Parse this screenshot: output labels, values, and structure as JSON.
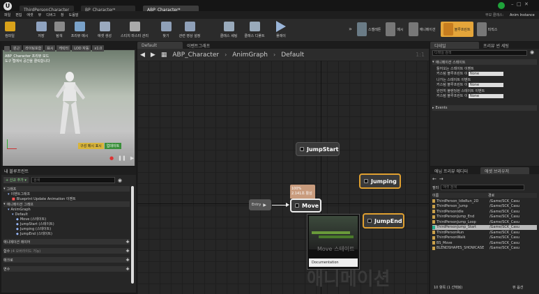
{
  "tabs": {
    "t1": "ThirdPersonCharacter",
    "t2": "BP_Character*",
    "t3": "ABP_Character*"
  },
  "menu": [
    "파일",
    "편집",
    "애셋",
    "뷰",
    "디버그",
    "창",
    "도움말"
  ],
  "top_right": {
    "parent": "부모 클래스:",
    "parent_value": "Anim Instance"
  },
  "toolbar": [
    "컴파일",
    "저장",
    "탐색",
    "프리뷰 메시",
    "애셋 생성",
    "스티치 마스터 관리",
    "찾기",
    "클래스 세팅",
    "클래스 디폴트",
    "플레이"
  ],
  "toolbar_misc": "관련 영상 설정",
  "modes": [
    "스켈레톤",
    "메시",
    "애니메이션",
    "블루프린트",
    "피직스"
  ],
  "viewport": {
    "buttons": [
      "원근",
      "라이팅포함",
      "표시",
      "캐릭터",
      "LOD 자동",
      "x1.0"
    ],
    "info1": "ABP_Character 프리뷰 모드",
    "info2": "도구 탭에서 공간을 클릭합니다",
    "overlay1": "구성 메시 표시",
    "overlay2": "업데이트"
  },
  "mybp": {
    "title": "내 블루프린트",
    "add": "+ 신규 추가 ▾",
    "search": "검색",
    "sec_graph": "그래프",
    "eventgraph": "이벤트그래프",
    "bp_update": "Blueprint Update Animation 이벤트",
    "animgraph_sec": "애니메이션 그래프",
    "animgraph": "AnimGraph",
    "default": "Default",
    "items": [
      "Move (스테이트)",
      "JumpStart (스테이트)",
      "Jumping (스테이트)",
      "JumpEnd (스테이트)"
    ],
    "anim_layers": "애니메이션 레이어",
    "functions": "함수",
    "functions_count": "(4 오버라이드 가능)",
    "macros": "매크로",
    "variables": "변수"
  },
  "graph": {
    "tab_default": "Default",
    "tab_event": "이벤트그래프",
    "breadcrumb_root": "ABP_Character",
    "breadcrumb_mid": "AnimGraph",
    "breadcrumb_leaf": "Default",
    "zoom": "1:1",
    "entry": "Entry",
    "nodes": {
      "jumpstart": "JumpStart",
      "jumping": "Jumping",
      "move": "Move",
      "jumpend": "JumpEnd"
    },
    "move_pct": "100%",
    "move_active": "2.141초 활성",
    "tooltip_caption": "Move 스테이트",
    "tooltip_doc": "Documentation",
    "watermark": "애니메이션"
  },
  "details": {
    "tab1": "디테일",
    "tab2": "프리뷰 씬 세팅",
    "search": "디테일 검색",
    "section": "애니메이션 스테이트",
    "enter": "들어오는 스테이트 이벤트",
    "custom_bp": "커스텀 블루프린트 이",
    "none": "None",
    "exit": "나가는 스테이트 이벤트",
    "fully": "완전히 블렌딩된 스테이트 이벤트",
    "events": "Events"
  },
  "assets": {
    "tab1": "애님 프리뷰 에디터",
    "tab2": "애셋 브라우저",
    "filter": "필터",
    "search": "애셋 검색",
    "col_name": "이름",
    "col_path": "경로",
    "rows": [
      {
        "n": "ThirdPerson_IdleRun_2D",
        "p": "/Game/SCK_Casu"
      },
      {
        "n": "ThirdPerson_Jump",
        "p": "/Game/SCK_Casu"
      },
      {
        "n": "ThirdPersonIdle",
        "p": "/Game/SCK_Casu"
      },
      {
        "n": "ThirdPersonJump_End",
        "p": "/Game/SCK_Casu"
      },
      {
        "n": "ThirdPersonJump_Loop",
        "p": "/Game/SCK_Casu"
      },
      {
        "n": "ThirdPersonJump_Start",
        "p": "/Game/SCK_Casu"
      },
      {
        "n": "ThirdPersonRun",
        "p": "/Game/SCK_Casu"
      },
      {
        "n": "ThirdPersonWalk",
        "p": "/Game/SCK_Casu"
      },
      {
        "n": "BS_Move",
        "p": "/Game/SCK_Casu"
      },
      {
        "n": "BLENDSHAPES_SHOWCASE",
        "p": "/Game/SCK_Casu"
      }
    ],
    "count": "10 항목 (1 선택됨)",
    "view": "뷰 옵션"
  }
}
